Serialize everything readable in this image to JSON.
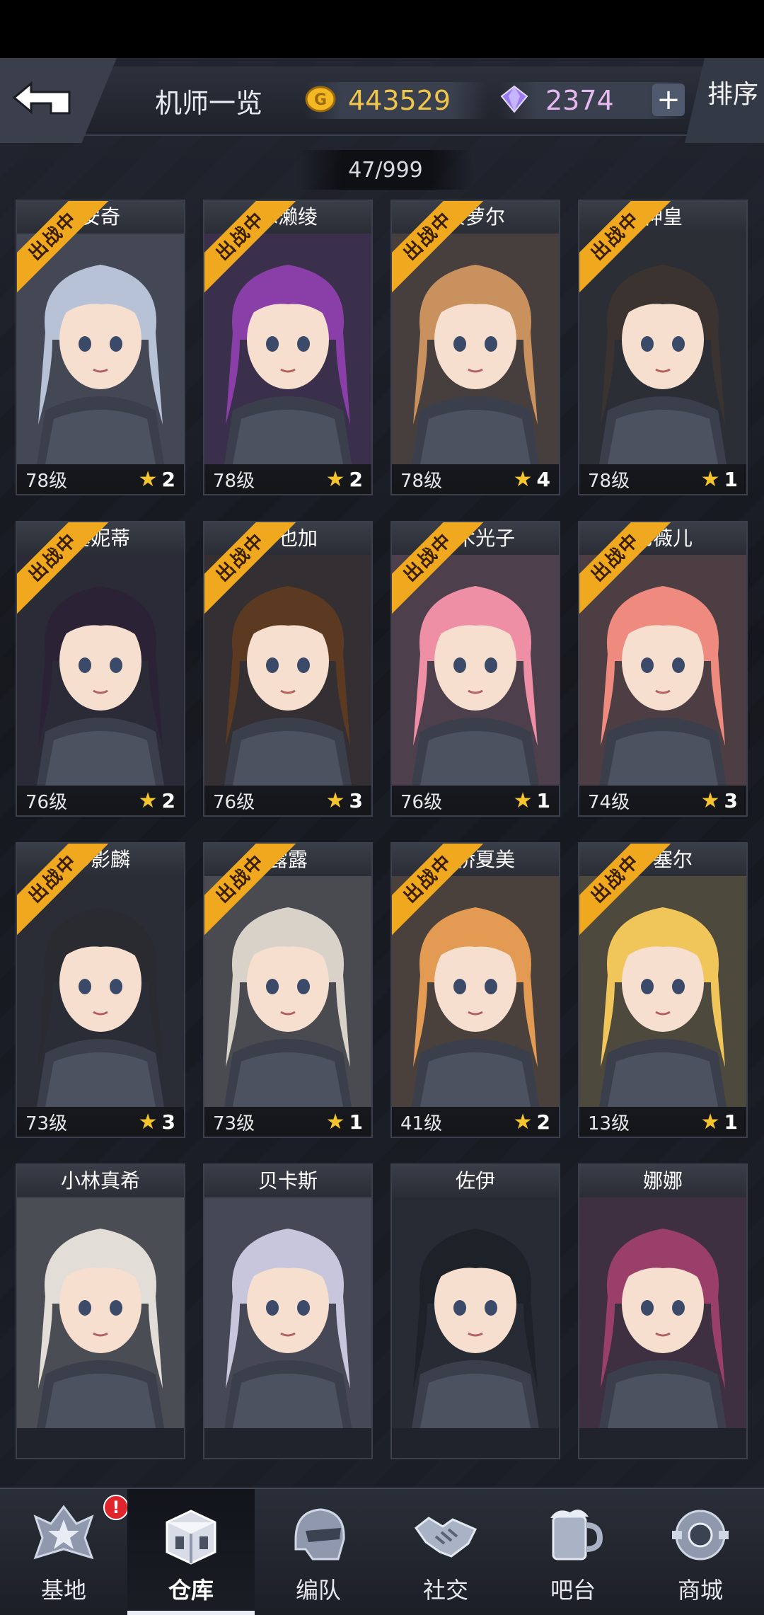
{
  "header": {
    "title": "机师一览",
    "coins": "443529",
    "gems": "2374",
    "plus_label": "+",
    "sort_label": "排序",
    "back_icon": "back-arrow-icon"
  },
  "roster_count": "47/999",
  "deployed_label": "出战中",
  "pilots": [
    {
      "name": "安奇",
      "level": "78级",
      "stars": "2",
      "deployed": true,
      "hair": "#b7c2d6"
    },
    {
      "name": "水濑绫",
      "level": "78级",
      "stars": "2",
      "deployed": true,
      "hair": "#8a3ea8"
    },
    {
      "name": "索萝尔",
      "level": "78级",
      "stars": "4",
      "deployed": true,
      "hair": "#c9915e"
    },
    {
      "name": "神皇",
      "level": "78级",
      "stars": "1",
      "deployed": true,
      "hair": "#3a3330"
    },
    {
      "name": "塞妮蒂",
      "level": "76级",
      "stars": "2",
      "deployed": true,
      "hair": "#2b2236"
    },
    {
      "name": "沙也加",
      "level": "76级",
      "stars": "3",
      "deployed": true,
      "hair": "#5c3a22"
    },
    {
      "name": "铃木光子",
      "level": "76级",
      "stars": "1",
      "deployed": true,
      "hair": "#ee8fa6"
    },
    {
      "name": "尼薇儿",
      "level": "74级",
      "stars": "3",
      "deployed": true,
      "hair": "#ef8a7e"
    },
    {
      "name": "彭影麟",
      "level": "73级",
      "stars": "3",
      "deployed": true,
      "hair": "#2a2b30"
    },
    {
      "name": "露露",
      "level": "73级",
      "stars": "1",
      "deployed": true,
      "hair": "#d8d2c8"
    },
    {
      "name": "高桥夏美",
      "level": "41级",
      "stars": "2",
      "deployed": true,
      "hair": "#e39a52"
    },
    {
      "name": "梦塞尔",
      "level": "13级",
      "stars": "1",
      "deployed": true,
      "hair": "#f0c55a"
    },
    {
      "name": "小林真希",
      "level": "",
      "stars": "",
      "deployed": false,
      "hair": "#e2ddd6"
    },
    {
      "name": "贝卡斯",
      "level": "",
      "stars": "",
      "deployed": false,
      "hair": "#c8c6dc"
    },
    {
      "name": "佐伊",
      "level": "",
      "stars": "",
      "deployed": false,
      "hair": "#1d2228"
    },
    {
      "name": "娜娜",
      "level": "",
      "stars": "",
      "deployed": false,
      "hair": "#9a3f6a"
    }
  ],
  "nav": [
    {
      "label": "基地",
      "icon": "star-badge-icon",
      "badge": "!"
    },
    {
      "label": "仓库",
      "icon": "crate-icon",
      "active": true
    },
    {
      "label": "编队",
      "icon": "helmet-icon"
    },
    {
      "label": "社交",
      "icon": "handshake-icon"
    },
    {
      "label": "吧台",
      "icon": "mug-icon"
    },
    {
      "label": "商城",
      "icon": "shop-orb-icon"
    }
  ]
}
